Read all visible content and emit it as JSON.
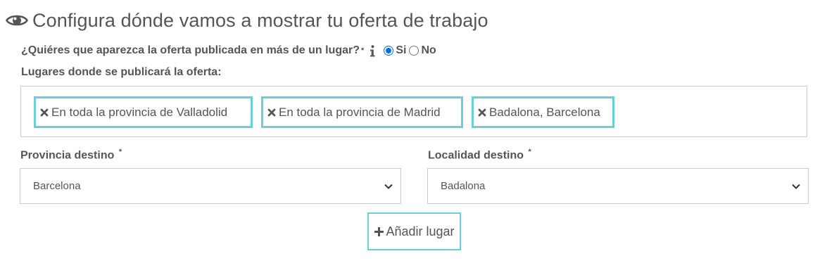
{
  "header": {
    "icon": "eye-icon",
    "title": "Configura dónde vamos a mostrar tu oferta de trabajo"
  },
  "question": {
    "text": "¿Quiéres que aparezca la oferta publicada en más de un lugar?",
    "required_mark": "*",
    "info_icon": "info-icon",
    "options": [
      {
        "label": "Si",
        "checked": true
      },
      {
        "label": "No",
        "checked": false
      }
    ]
  },
  "places": {
    "label": "Lugares donde se publicará la oferta:",
    "tags": [
      {
        "label": "En toda la provincia de Valladolid",
        "icon": "remove-icon"
      },
      {
        "label": "En toda la provincia de Madrid",
        "icon": "remove-icon"
      },
      {
        "label": "Badalona, Barcelona",
        "icon": "remove-icon"
      }
    ]
  },
  "provincia": {
    "label": "Provincia destino",
    "required_mark": "*",
    "value": "Barcelona"
  },
  "localidad": {
    "label": "Localidad destino",
    "required_mark": "*",
    "value": "Badalona"
  },
  "add_button": {
    "icon": "plus-icon",
    "label": "Añadir lugar"
  },
  "colors": {
    "accent_border": "#68cfdb",
    "radio": "#0b6fe0",
    "text": "#555555"
  }
}
